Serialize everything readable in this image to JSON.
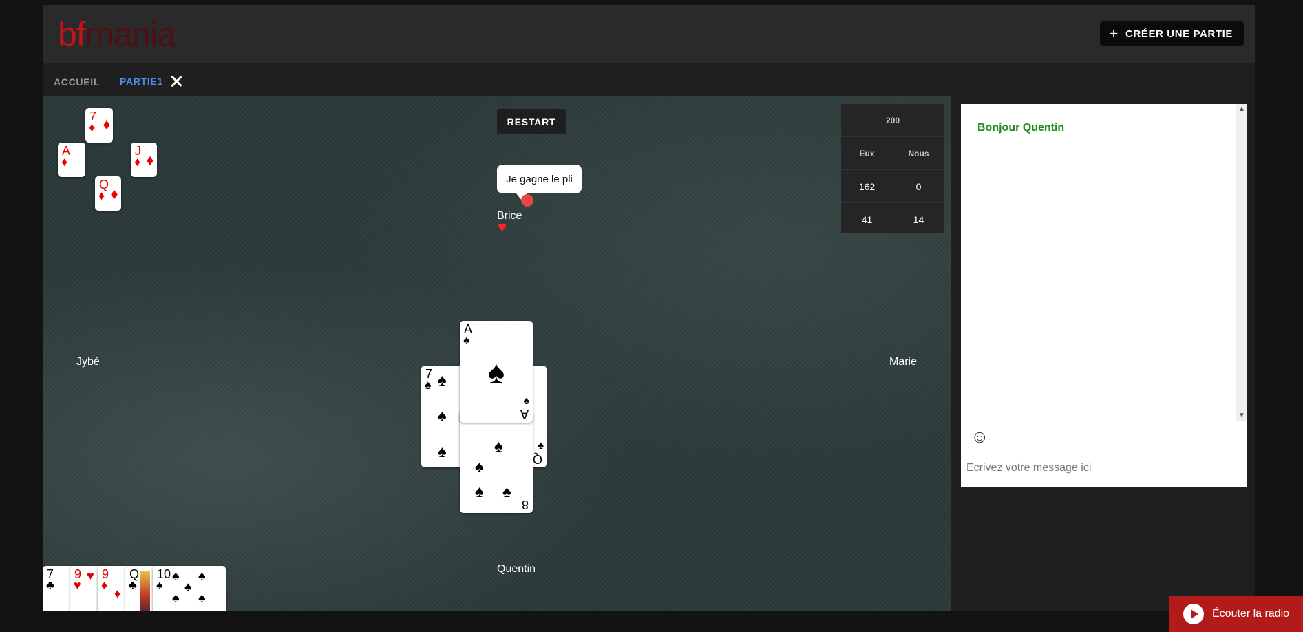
{
  "logo": {
    "text_a": "bf",
    "text_b": "mania"
  },
  "header": {
    "create_label": "CRÉER UNE PARTIE"
  },
  "tabs": [
    {
      "label": "ACCUEIL"
    },
    {
      "label": "PARTIE1"
    }
  ],
  "table": {
    "restart_label": "RESTART",
    "speech": "Je gagne le pli",
    "players": {
      "top": "Brice",
      "left": "Jybé",
      "right": "Marie",
      "bottom": "Quentin"
    }
  },
  "score": {
    "target": "200",
    "headers": [
      "Eux",
      "Nous"
    ],
    "rows": [
      [
        "162",
        "0"
      ],
      [
        "41",
        "14"
      ]
    ]
  },
  "last_trick": [
    {
      "rank": "7",
      "suit": "♦",
      "color": "#e00000"
    },
    {
      "rank": "A",
      "suit": "♦",
      "color": "#e00000"
    },
    {
      "rank": "J",
      "suit": "♦",
      "color": "#e00000"
    },
    {
      "rank": "Q",
      "suit": "♦",
      "color": "#e00000"
    }
  ],
  "center_cards": [
    {
      "rank": "7",
      "suit": "♠"
    },
    {
      "rank": "Q",
      "suit": "♠"
    },
    {
      "rank": "8",
      "suit": "♠"
    },
    {
      "rank": "A",
      "suit": "♠"
    }
  ],
  "hand": [
    {
      "rank": "7",
      "suit": "♣"
    },
    {
      "rank": "9",
      "suit": "♥"
    },
    {
      "rank": "9",
      "suit": "♦"
    },
    {
      "rank": "Q",
      "suit": "♣"
    },
    {
      "rank": "10",
      "suit": "♠"
    }
  ],
  "chat": {
    "messages": [
      {
        "text": "Bonjour Quentin",
        "color": "#1f8a1f"
      }
    ],
    "placeholder": "Ecrivez votre message ici",
    "emoji_icon": "smiley-icon"
  },
  "radio": {
    "label": "Écouter la radio"
  }
}
